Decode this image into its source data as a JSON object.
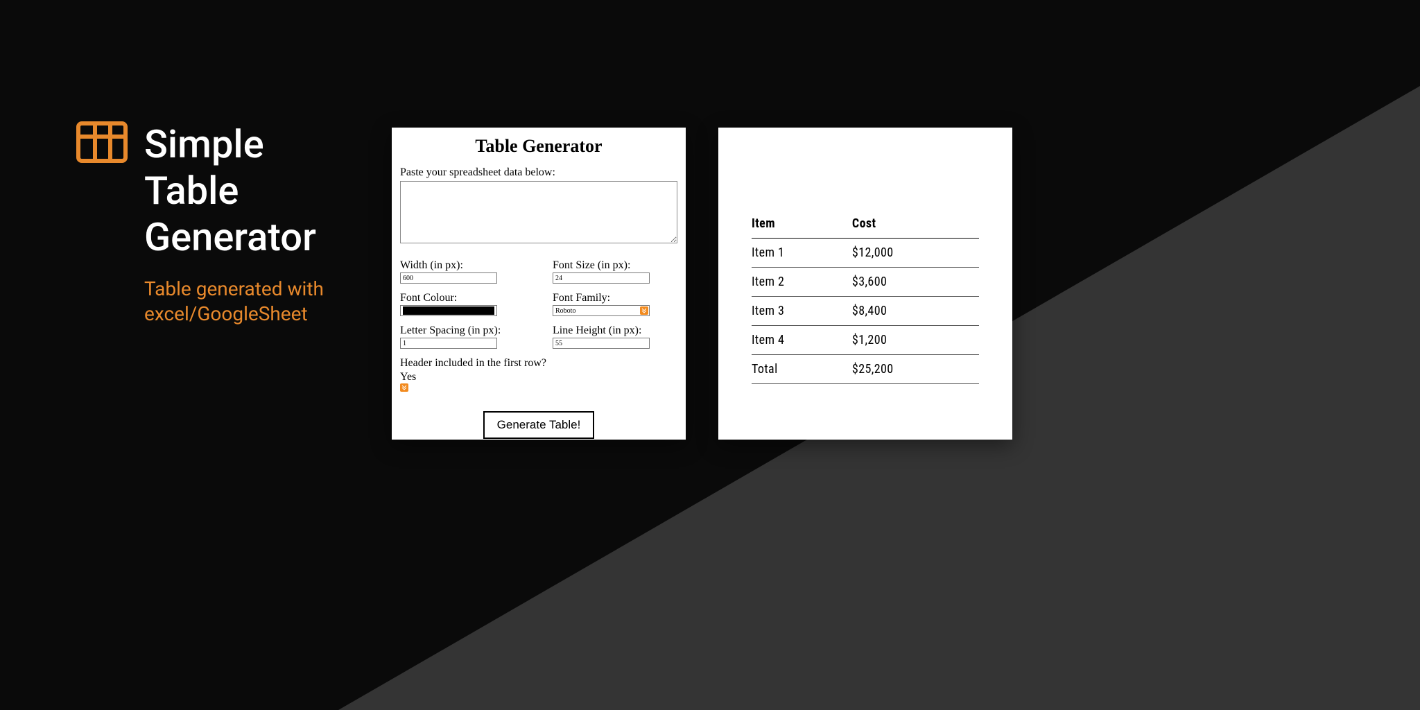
{
  "hero": {
    "title_l1": "Simple",
    "title_l2": "Table",
    "title_l3": "Generator",
    "sub_l1": "Table generated with",
    "sub_l2": "excel/GoogleSheet"
  },
  "form": {
    "heading": "Table Generator",
    "paste_label": "Paste your spreadsheet data below:",
    "width_label": "Width (in px):",
    "width_value": "600",
    "fontsize_label": "Font Size (in px):",
    "fontsize_value": "24",
    "fontcolour_label": "Font Colour:",
    "fontcolour_value": "#000000",
    "fontfamily_label": "Font Family:",
    "fontfamily_value": "Roboto",
    "letterspacing_label": "Letter Spacing (in px):",
    "letterspacing_value": "1",
    "lineheight_label": "Line Height (in px):",
    "lineheight_value": "55",
    "header_label": "Header included in the first row?",
    "header_value": "Yes",
    "button_label": "Generate Table!"
  },
  "output": {
    "columns": [
      "Item",
      "Cost"
    ],
    "rows": [
      [
        "Item 1",
        "$12,000"
      ],
      [
        "Item 2",
        "$3,600"
      ],
      [
        "Item 3",
        "$8,400"
      ],
      [
        "Item 4",
        "$1,200"
      ],
      [
        "Total",
        "$25,200"
      ]
    ]
  },
  "chart_data": {
    "type": "table",
    "title": "",
    "columns": [
      "Item",
      "Cost"
    ],
    "rows": [
      {
        "Item": "Item 1",
        "Cost": 12000
      },
      {
        "Item": "Item 2",
        "Cost": 3600
      },
      {
        "Item": "Item 3",
        "Cost": 8400
      },
      {
        "Item": "Item 4",
        "Cost": 1200
      },
      {
        "Item": "Total",
        "Cost": 25200
      }
    ]
  }
}
